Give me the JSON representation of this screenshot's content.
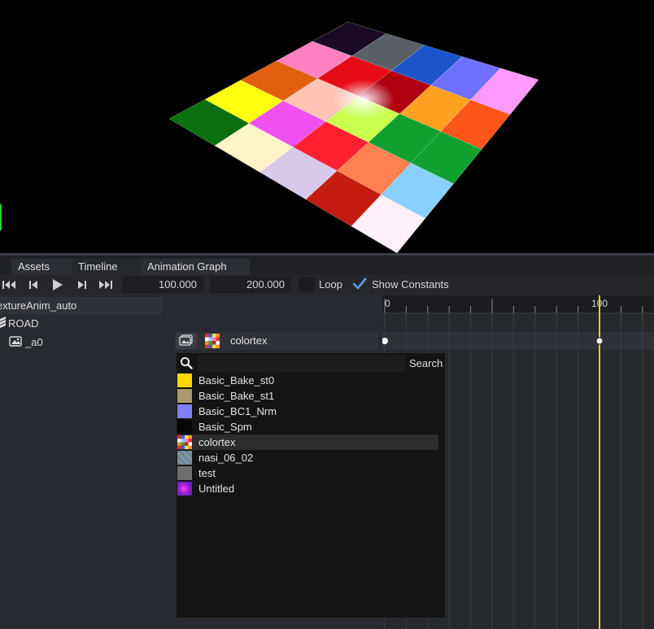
{
  "tabs": [
    {
      "label": "Assets"
    },
    {
      "label": "Timeline"
    },
    {
      "label": "Animation Graph"
    }
  ],
  "toolbar": {
    "start_value": "100.000",
    "end_value": "200.000",
    "loop_label": "Loop",
    "loop_checked": false,
    "show_constants_label": "Show Constants",
    "show_constants_checked": true
  },
  "tree": {
    "root_label": "extureAnim_auto",
    "road_label": "ROAD",
    "a0_label": "_a0"
  },
  "property": {
    "texture_name": "colortex"
  },
  "timeline": {
    "ruler_labels": [
      "0",
      "100"
    ],
    "playhead_frame": 100
  },
  "dropdown": {
    "search_placeholder": "",
    "search_label": "Search",
    "items": [
      {
        "label": "Basic_Bake_st0",
        "swatch": "#ffd700"
      },
      {
        "label": "Basic_Bake_st1",
        "swatch": "#a8996e"
      },
      {
        "label": "Basic_BC1_Nrm",
        "swatch": "#8080ff"
      },
      {
        "label": "Basic_Spm",
        "swatch": "#050505"
      },
      {
        "label": "colortex",
        "swatch": "checker",
        "selected": true
      },
      {
        "label": "nasi_06_02",
        "swatch": "#6d8796"
      },
      {
        "label": "test",
        "swatch": "#6e6e6e"
      },
      {
        "label": "Untitled",
        "swatch": "gradient"
      }
    ]
  },
  "colors": {
    "accent": "#4a9fe8",
    "playhead": "#e8c82a",
    "panel_bg": "#272a30"
  }
}
